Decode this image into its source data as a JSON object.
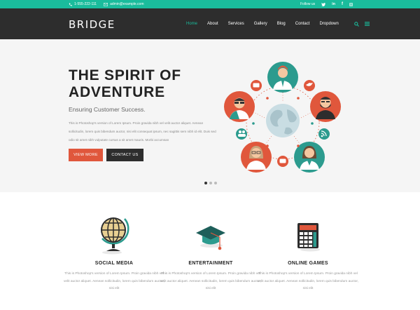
{
  "topbar": {
    "phone": "1-555-222-111",
    "email": "admin@example.com",
    "follow": "Follow us"
  },
  "header": {
    "logo": "BRIDGE",
    "nav": [
      "Home",
      "About",
      "Services",
      "Gallery",
      "Blog",
      "Contact",
      "Dropdown"
    ]
  },
  "hero": {
    "title": "THE SPIRIT OF ADVENTURE",
    "subtitle": "Ensuring Customer Success.",
    "description": "This is Photoshop's version of Lorem Ipsum. Proin gravida nibh vel velit auctor aliquet. Aenean sollicitudin, lorem quis bibendum auctor, nisi elit consequat ipsum, nec sagittis sem nibh id elit. Duis sed odio sit amet nibh vulputate cursus a sit amet mauris. Morbi accumsan",
    "btn_view": "VIEW MORE",
    "btn_contact": "CONTACT US"
  },
  "features": [
    {
      "title": "SOCIAL MEDIA",
      "text": "This is Photoshop's version of Lorem Ipsum. Proin gravida nibh vel velit auctor aliquet. Aenean sollicitudin, lorem quis bibendum auctor, nisi elit"
    },
    {
      "title": "ENTERTAINMENT",
      "text": "This is Photoshop's version of Lorem Ipsum. Proin gravida nibh vel velit auctor aliquet. Aenean sollicitudin, lorem quis bibendum auctor, nisi elit"
    },
    {
      "title": "ONLINE GAMES",
      "text": "This is Photoshop's version of Lorem Ipsum. Proin gravida nibh vel velit auctor aliquet. Aenean sollicitudin, lorem quis bibendum auctor, nisi elit"
    }
  ],
  "colors": {
    "accent": "#1abc9c",
    "orange": "#e0573c",
    "dark": "#2d2d2d"
  }
}
